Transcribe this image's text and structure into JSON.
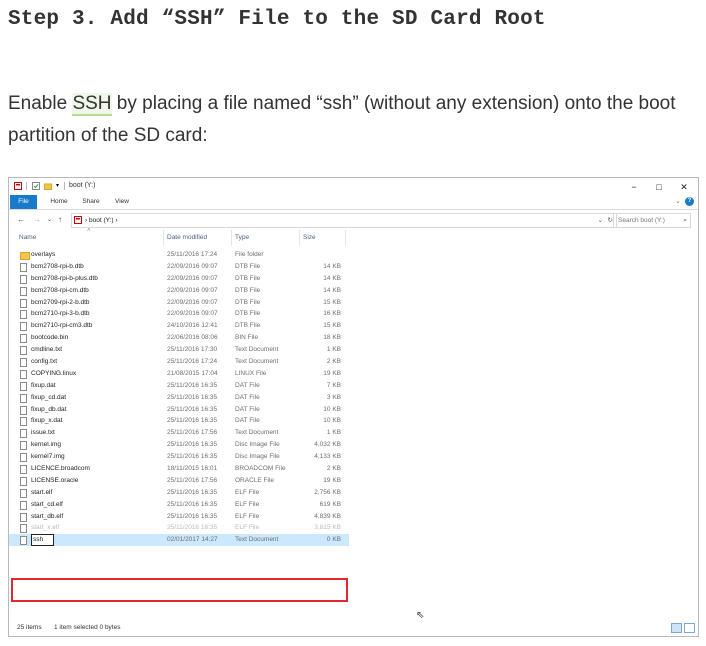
{
  "article": {
    "heading": "Step 3. Add “SSH” File to the SD Card Root",
    "intro_before": "Enable ",
    "intro_highlight": "SSH",
    "intro_after": " by placing a file named “ssh” (without any extension) onto the boot partition of the SD card:"
  },
  "window": {
    "title": "boot (Y:)",
    "controls": {
      "minimize": "−",
      "maximize": "□",
      "close": "✕"
    },
    "ribbon_tabs": [
      "File",
      "Home",
      "Share",
      "View"
    ],
    "help": "?",
    "nav": {
      "back": "←",
      "forward": "→",
      "recent": "⌄",
      "up": "↑"
    },
    "address": "boot (Y:)",
    "address_chevrons": "›",
    "search_placeholder": "Search boot (Y:)",
    "columns": {
      "name": "Name",
      "date": "Date modified",
      "type": "Type",
      "size": "Size"
    },
    "files": [
      {
        "name": "overlays",
        "date": "25/11/2016 17:24",
        "type": "File folder",
        "size": "",
        "icon": "folder-icon"
      },
      {
        "name": "bcm2708-rpi-b.dtb",
        "date": "22/09/2016 09:07",
        "type": "DTB File",
        "size": "14 KB",
        "icon": "file-icon"
      },
      {
        "name": "bcm2708-rpi-b-plus.dtb",
        "date": "22/09/2016 09:07",
        "type": "DTB File",
        "size": "14 KB",
        "icon": "file-icon"
      },
      {
        "name": "bcm2708-rpi-cm.dtb",
        "date": "22/09/2016 09:07",
        "type": "DTB File",
        "size": "14 KB",
        "icon": "file-icon"
      },
      {
        "name": "bcm2709-rpi-2-b.dtb",
        "date": "22/09/2016 09:07",
        "type": "DTB File",
        "size": "15 KB",
        "icon": "file-icon"
      },
      {
        "name": "bcm2710-rpi-3-b.dtb",
        "date": "22/09/2016 09:07",
        "type": "DTB File",
        "size": "16 KB",
        "icon": "file-icon"
      },
      {
        "name": "bcm2710-rpi-cm3.dtb",
        "date": "24/10/2016 12:41",
        "type": "DTB File",
        "size": "15 KB",
        "icon": "file-icon"
      },
      {
        "name": "bootcode.bin",
        "date": "22/06/2016 08:06",
        "type": "BIN File",
        "size": "18 KB",
        "icon": "file-icon"
      },
      {
        "name": "cmdline.txt",
        "date": "25/11/2016 17:30",
        "type": "Text Document",
        "size": "1 KB",
        "icon": "file-icon"
      },
      {
        "name": "config.txt",
        "date": "25/11/2016 17:24",
        "type": "Text Document",
        "size": "2 KB",
        "icon": "file-icon"
      },
      {
        "name": "COPYING.linux",
        "date": "21/08/2015 17:04",
        "type": "LINUX File",
        "size": "19 KB",
        "icon": "file-icon"
      },
      {
        "name": "fixup.dat",
        "date": "25/11/2016 16:35",
        "type": "DAT File",
        "size": "7 KB",
        "icon": "file-icon"
      },
      {
        "name": "fixup_cd.dat",
        "date": "25/11/2016 16:35",
        "type": "DAT File",
        "size": "3 KB",
        "icon": "file-icon"
      },
      {
        "name": "fixup_db.dat",
        "date": "25/11/2016 16:35",
        "type": "DAT File",
        "size": "10 KB",
        "icon": "file-icon"
      },
      {
        "name": "fixup_x.dat",
        "date": "25/11/2016 16:35",
        "type": "DAT File",
        "size": "10 KB",
        "icon": "file-icon"
      },
      {
        "name": "issue.txt",
        "date": "25/11/2016 17:56",
        "type": "Text Document",
        "size": "1 KB",
        "icon": "file-icon"
      },
      {
        "name": "kernel.img",
        "date": "25/11/2016 16:35",
        "type": "Disc Image File",
        "size": "4,032 KB",
        "icon": "file-icon"
      },
      {
        "name": "kernel7.img",
        "date": "25/11/2016 16:35",
        "type": "Disc Image File",
        "size": "4,133 KB",
        "icon": "file-icon"
      },
      {
        "name": "LICENCE.broadcom",
        "date": "18/11/2015 16:01",
        "type": "BROADCOM File",
        "size": "2 KB",
        "icon": "file-icon"
      },
      {
        "name": "LICENSE.oracle",
        "date": "25/11/2016 17:56",
        "type": "ORACLE File",
        "size": "19 KB",
        "icon": "file-icon"
      },
      {
        "name": "start.elf",
        "date": "25/11/2016 16:35",
        "type": "ELF File",
        "size": "2,756 KB",
        "icon": "file-icon"
      },
      {
        "name": "start_cd.elf",
        "date": "25/11/2016 16:35",
        "type": "ELF File",
        "size": "619 KB",
        "icon": "file-icon"
      },
      {
        "name": "start_db.elf",
        "date": "25/11/2016 16:35",
        "type": "ELF File",
        "size": "4,839 KB",
        "icon": "file-icon"
      },
      {
        "name": "start_x.elf",
        "date": "25/11/2016 16:35",
        "type": "ELF File",
        "size": "3,815 KB",
        "icon": "file-icon",
        "faded": true
      },
      {
        "name": "ssh",
        "date": "02/01/2017 14:27",
        "type": "Text Document",
        "size": "0 KB",
        "icon": "file-icon",
        "selected": true
      }
    ],
    "status": {
      "count": "25 items",
      "selection": "1 item selected  0 bytes"
    },
    "colors": {
      "accent": "#1979ca",
      "selection": "#cce8ff",
      "highlight_box": "#e0282e",
      "folder": "#f3c64a"
    }
  }
}
